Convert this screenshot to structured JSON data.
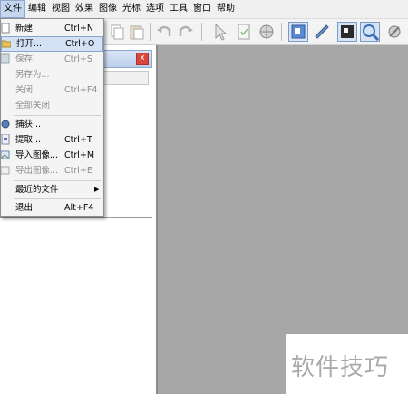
{
  "menubar": {
    "items": [
      "文件",
      "编辑",
      "视图",
      "效果",
      "图像",
      "光标",
      "选项",
      "工具",
      "窗口",
      "帮助"
    ]
  },
  "file_menu": {
    "items": [
      {
        "label": "新建",
        "shortcut": "Ctrl+N",
        "enabled": true
      },
      {
        "label": "打开...",
        "shortcut": "Ctrl+O",
        "enabled": true,
        "highlighted": true
      },
      {
        "label": "保存",
        "shortcut": "Ctrl+S",
        "enabled": false
      },
      {
        "label": "另存为...",
        "shortcut": "",
        "enabled": false
      },
      {
        "label": "关闭",
        "shortcut": "Ctrl+F4",
        "enabled": false
      },
      {
        "label": "全部关闭",
        "shortcut": "",
        "enabled": false
      },
      {
        "label": "捕获...",
        "shortcut": "",
        "enabled": true
      },
      {
        "label": "提取...",
        "shortcut": "Ctrl+T",
        "enabled": true
      },
      {
        "label": "导入图像...",
        "shortcut": "Ctrl+M",
        "enabled": true
      },
      {
        "label": "导出图像...",
        "shortcut": "Ctrl+E",
        "enabled": false
      },
      {
        "label": "最近的文件",
        "shortcut": "",
        "enabled": true,
        "submenu": true
      },
      {
        "label": "退出",
        "shortcut": "Alt+F4",
        "enabled": true
      }
    ]
  },
  "panel": {
    "close_glyph": "x"
  },
  "watermark": {
    "text": "软件技巧"
  },
  "colors": {
    "workspace": "#a7a7a7",
    "menu_highlight": "#d3e2f5",
    "disabled_text": "#8d8d8d"
  }
}
